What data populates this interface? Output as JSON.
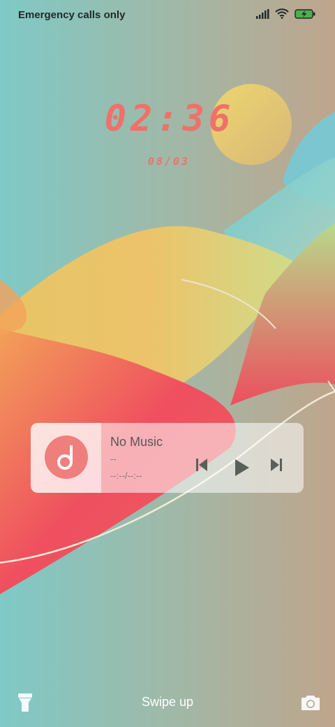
{
  "status_bar": {
    "carrier": "Emergency calls only",
    "icons": [
      "signal-icon",
      "wifi-icon",
      "battery-charging-icon"
    ],
    "battery_color": "#4caf50"
  },
  "lockscreen": {
    "time": "02:36",
    "date": "08/03",
    "accent_color": "#f0706a"
  },
  "music": {
    "title": "No Music",
    "artist": "--",
    "time": "--:--/--:--",
    "album_icon": "music-note-icon",
    "controls": [
      "previous-icon",
      "play-icon",
      "next-icon"
    ]
  },
  "bottom": {
    "hint": "Swipe up",
    "left_icon": "flashlight-icon",
    "right_icon": "camera-icon"
  }
}
